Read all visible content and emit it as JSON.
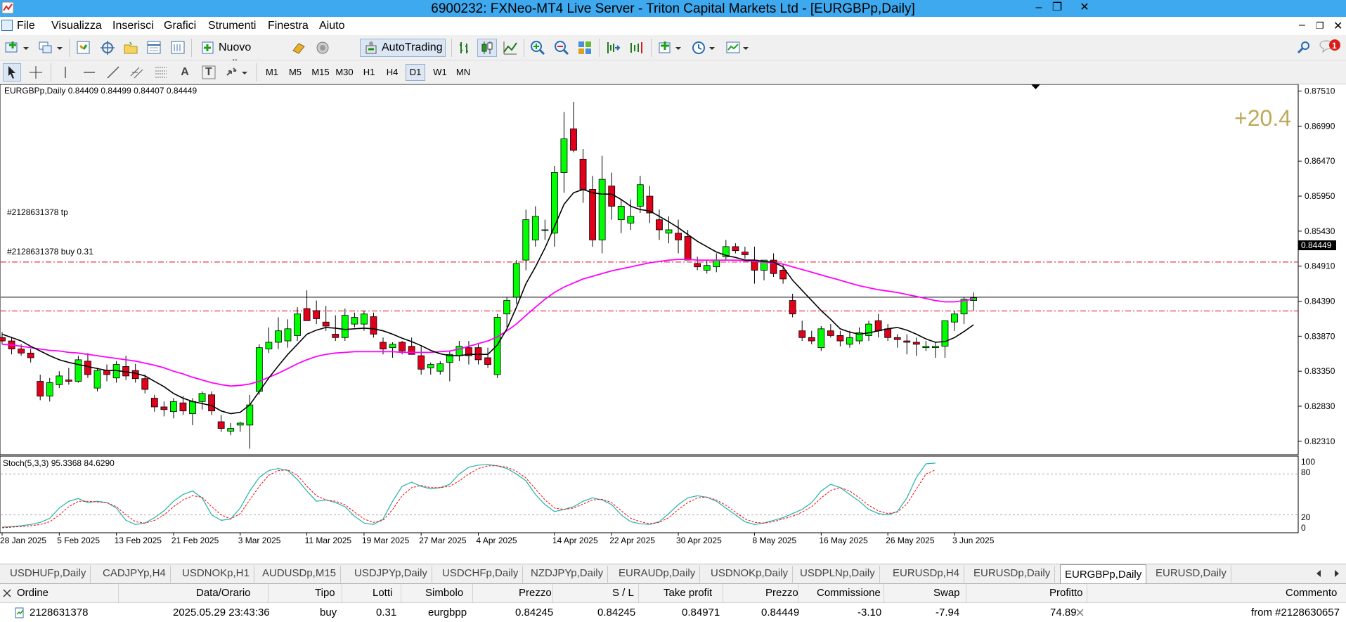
{
  "window": {
    "title": "6900232: FXNeo-MT4 Live Server - Triton Capital Markets Ltd - [EURGBPp,Daily]",
    "controls": [
      "–",
      "❐",
      "✕"
    ],
    "mdi_controls": [
      "–",
      "❐",
      "✕"
    ]
  },
  "menu": [
    "File",
    "Visualizza",
    "Inserisci",
    "Grafici",
    "Strumenti",
    "Finestra",
    "Aiuto"
  ],
  "toolbar": {
    "new_order_label": "Nuovo ordine",
    "autotrading_label": "AutoTrading",
    "notification_count": "1"
  },
  "drawing_tools": {
    "text_tool": "A",
    "label_tool": "T"
  },
  "timeframes": [
    "M1",
    "M5",
    "M15",
    "M30",
    "H1",
    "H4",
    "D1",
    "W1",
    "MN"
  ],
  "selected_timeframe": "D1",
  "chart": {
    "header": "EURGBPp,Daily  0.84409 0.84499 0.84407 0.84449",
    "profit_overlay": "+20.4",
    "tp_label": "#2128631378 tp",
    "buy_label": "#2128631378 buy 0.31",
    "current_price": "0.84449",
    "colors": {
      "bull": "#00ff00",
      "bear": "#e0001a",
      "ma_fast": "#000000",
      "ma_slow": "#ff00ff",
      "stoch_main": "#20b2aa",
      "stoch_signal": "#ff0000",
      "profit": "#bfa95a"
    }
  },
  "stoch": {
    "header": "Stoch(5,3,3) 95.3368 84.6290",
    "levels": [
      "100",
      "80",
      "20",
      "0"
    ]
  },
  "chart_data": {
    "type": "candlestick",
    "title": "EURGBPp,Daily",
    "y_ticks": [
      "0.87510",
      "0.86990",
      "0.86470",
      "0.85950",
      "0.85430",
      "0.84910",
      "0.84390",
      "0.83870",
      "0.83350",
      "0.82830",
      "0.82310"
    ],
    "ylim": [
      0.8211,
      0.8761
    ],
    "x_labels": [
      "28 Jan 2025",
      "5 Feb 2025",
      "13 Feb 2025",
      "21 Feb 2025",
      "3 Mar 2025",
      "11 Mar 2025",
      "19 Mar 2025",
      "27 Mar 2025",
      "4 Apr 2025",
      "14 Apr 2025",
      "22 Apr 2025",
      "30 Apr 2025",
      "8 May 2025",
      "16 May 2025",
      "26 May 2025",
      "3 Jun 2025"
    ],
    "ohlc": [
      [
        0.8385,
        0.8393,
        0.8375,
        0.838
      ],
      [
        0.838,
        0.8386,
        0.836,
        0.8368
      ],
      [
        0.8368,
        0.8375,
        0.8358,
        0.8362
      ],
      [
        0.8362,
        0.8368,
        0.8348,
        0.8355
      ],
      [
        0.832,
        0.833,
        0.8292,
        0.8298
      ],
      [
        0.8298,
        0.8325,
        0.829,
        0.8318
      ],
      [
        0.8315,
        0.8335,
        0.831,
        0.8328
      ],
      [
        0.8322,
        0.834,
        0.8315,
        0.832
      ],
      [
        0.832,
        0.8358,
        0.8318,
        0.8352
      ],
      [
        0.835,
        0.8362,
        0.8325,
        0.833
      ],
      [
        0.831,
        0.834,
        0.8305,
        0.8336
      ],
      [
        0.8336,
        0.8345,
        0.832,
        0.833
      ],
      [
        0.8325,
        0.835,
        0.8318,
        0.8345
      ],
      [
        0.8342,
        0.8358,
        0.8322,
        0.8328
      ],
      [
        0.8336,
        0.8346,
        0.8318,
        0.8324
      ],
      [
        0.8324,
        0.833,
        0.8302,
        0.8308
      ],
      [
        0.8295,
        0.83,
        0.8275,
        0.8282
      ],
      [
        0.8282,
        0.829,
        0.8268,
        0.8278
      ],
      [
        0.8275,
        0.8295,
        0.8265,
        0.829
      ],
      [
        0.8288,
        0.8298,
        0.827,
        0.8276
      ],
      [
        0.8272,
        0.8295,
        0.8255,
        0.829
      ],
      [
        0.829,
        0.8305,
        0.8278,
        0.8302
      ],
      [
        0.83,
        0.8305,
        0.827,
        0.8276
      ],
      [
        0.826,
        0.827,
        0.8245,
        0.825
      ],
      [
        0.8246,
        0.8258,
        0.824,
        0.825
      ],
      [
        0.8255,
        0.826,
        0.8245,
        0.8258
      ],
      [
        0.8255,
        0.83,
        0.822,
        0.8285
      ],
      [
        0.8305,
        0.8375,
        0.83,
        0.837
      ],
      [
        0.8368,
        0.84,
        0.8362,
        0.8378
      ],
      [
        0.8378,
        0.8415,
        0.8368,
        0.8395
      ],
      [
        0.838,
        0.8412,
        0.837,
        0.8398
      ],
      [
        0.8388,
        0.843,
        0.838,
        0.842
      ],
      [
        0.8428,
        0.8455,
        0.841,
        0.841
      ],
      [
        0.8425,
        0.844,
        0.8405,
        0.8413
      ],
      [
        0.8408,
        0.8432,
        0.8395,
        0.8402
      ],
      [
        0.839,
        0.8418,
        0.838,
        0.8385
      ],
      [
        0.8385,
        0.8428,
        0.838,
        0.8418
      ],
      [
        0.8405,
        0.8422,
        0.84,
        0.8415
      ],
      [
        0.8405,
        0.8425,
        0.8395,
        0.842
      ],
      [
        0.8416,
        0.8422,
        0.8385,
        0.839
      ],
      [
        0.8378,
        0.8385,
        0.836,
        0.8368
      ],
      [
        0.837,
        0.8378,
        0.8355,
        0.8375
      ],
      [
        0.8378,
        0.838,
        0.836,
        0.8365
      ],
      [
        0.8372,
        0.8385,
        0.8365,
        0.836
      ],
      [
        0.8358,
        0.8372,
        0.833,
        0.8338
      ],
      [
        0.834,
        0.8348,
        0.833,
        0.8345
      ],
      [
        0.8335,
        0.835,
        0.833,
        0.8346
      ],
      [
        0.8348,
        0.8365,
        0.832,
        0.836
      ],
      [
        0.8358,
        0.838,
        0.835,
        0.8372
      ],
      [
        0.837,
        0.838,
        0.8345,
        0.8358
      ],
      [
        0.837,
        0.8375,
        0.8345,
        0.8352
      ],
      [
        0.8355,
        0.837,
        0.834,
        0.8345
      ],
      [
        0.833,
        0.842,
        0.8325,
        0.8415
      ],
      [
        0.842,
        0.8445,
        0.84,
        0.844
      ],
      [
        0.8445,
        0.85,
        0.8435,
        0.8495
      ],
      [
        0.85,
        0.8575,
        0.8485,
        0.856
      ],
      [
        0.853,
        0.858,
        0.852,
        0.8565
      ],
      [
        0.8545,
        0.856,
        0.853,
        0.8545
      ],
      [
        0.854,
        0.864,
        0.852,
        0.863
      ],
      [
        0.863,
        0.872,
        0.86,
        0.868
      ],
      [
        0.8695,
        0.8735,
        0.866,
        0.8663
      ],
      [
        0.865,
        0.8665,
        0.8585,
        0.8605
      ],
      [
        0.8605,
        0.8625,
        0.852,
        0.853
      ],
      [
        0.853,
        0.8655,
        0.851,
        0.862
      ],
      [
        0.861,
        0.863,
        0.856,
        0.858
      ],
      [
        0.856,
        0.859,
        0.854,
        0.858
      ],
      [
        0.8555,
        0.859,
        0.8545,
        0.8565
      ],
      [
        0.858,
        0.8625,
        0.857,
        0.8612
      ],
      [
        0.8595,
        0.861,
        0.8555,
        0.857
      ],
      [
        0.856,
        0.8575,
        0.853,
        0.8545
      ],
      [
        0.854,
        0.8565,
        0.8525,
        0.8545
      ],
      [
        0.854,
        0.856,
        0.851,
        0.853
      ],
      [
        0.8535,
        0.8545,
        0.85,
        0.85
      ],
      [
        0.8495,
        0.8505,
        0.8485,
        0.849
      ],
      [
        0.8485,
        0.85,
        0.848,
        0.8492
      ],
      [
        0.849,
        0.851,
        0.8482,
        0.85
      ],
      [
        0.8505,
        0.853,
        0.85,
        0.852
      ],
      [
        0.852,
        0.8525,
        0.851,
        0.8514
      ],
      [
        0.8512,
        0.852,
        0.8502,
        0.8508
      ],
      [
        0.85,
        0.852,
        0.8465,
        0.8485
      ],
      [
        0.8485,
        0.85,
        0.847,
        0.85
      ],
      [
        0.85,
        0.851,
        0.8475,
        0.848
      ],
      [
        0.8485,
        0.8495,
        0.8465,
        0.8472
      ],
      [
        0.844,
        0.845,
        0.8415,
        0.842
      ],
      [
        0.8395,
        0.841,
        0.838,
        0.8385
      ],
      [
        0.8385,
        0.8395,
        0.8375,
        0.838
      ],
      [
        0.837,
        0.8402,
        0.8365,
        0.8398
      ],
      [
        0.8395,
        0.8405,
        0.8385,
        0.8388
      ],
      [
        0.8388,
        0.8395,
        0.8372,
        0.838
      ],
      [
        0.8375,
        0.8395,
        0.837,
        0.8385
      ],
      [
        0.838,
        0.84,
        0.8375,
        0.8392
      ],
      [
        0.8388,
        0.841,
        0.838,
        0.8405
      ],
      [
        0.841,
        0.842,
        0.8385,
        0.8395
      ],
      [
        0.8398,
        0.8405,
        0.838,
        0.8385
      ],
      [
        0.8385,
        0.839,
        0.837,
        0.8382
      ],
      [
        0.838,
        0.839,
        0.836,
        0.8378
      ],
      [
        0.8378,
        0.8385,
        0.8358,
        0.8375
      ],
      [
        0.837,
        0.838,
        0.8365,
        0.8372
      ],
      [
        0.837,
        0.8378,
        0.8355,
        0.8372
      ],
      [
        0.8372,
        0.841,
        0.8355,
        0.841
      ],
      [
        0.8408,
        0.8425,
        0.8395,
        0.842
      ],
      [
        0.842,
        0.8445,
        0.8405,
        0.8442
      ],
      [
        0.844,
        0.8452,
        0.8425,
        0.8444
      ]
    ],
    "ma_slow": [
      0.8375,
      0.8374,
      0.8372,
      0.837,
      0.8368,
      0.8366,
      0.8365,
      0.8363,
      0.8362,
      0.836,
      0.8358,
      0.8356,
      0.8354,
      0.8352,
      0.835,
      0.8347,
      0.8344,
      0.834,
      0.8335,
      0.8331,
      0.8326,
      0.8322,
      0.8318,
      0.8315,
      0.8313,
      0.8314,
      0.8316,
      0.832,
      0.8326,
      0.8332,
      0.8339,
      0.8346,
      0.8352,
      0.8357,
      0.836,
      0.8362,
      0.8363,
      0.8364,
      0.8364,
      0.8364,
      0.8364,
      0.8364,
      0.8363,
      0.8363,
      0.8363,
      0.8363,
      0.8364,
      0.8365,
      0.8368,
      0.8372,
      0.8376,
      0.838,
      0.8386,
      0.8395,
      0.8405,
      0.8418,
      0.843,
      0.8442,
      0.8452,
      0.846,
      0.8466,
      0.8472,
      0.8476,
      0.848,
      0.8484,
      0.8487,
      0.849,
      0.8493,
      0.8496,
      0.8498,
      0.85,
      0.8501,
      0.8501,
      0.85,
      0.85,
      0.85,
      0.85,
      0.85,
      0.8499,
      0.8498,
      0.8497,
      0.8496,
      0.8494,
      0.849,
      0.8486,
      0.8482,
      0.8478,
      0.8474,
      0.847,
      0.8466,
      0.8462,
      0.8459,
      0.8456,
      0.8454,
      0.8452,
      0.8449,
      0.8446,
      0.8443,
      0.844,
      0.8438,
      0.8438,
      0.844,
      0.8442
    ],
    "ma_fast": [
      0.839,
      0.8385,
      0.838,
      0.8372,
      0.8365,
      0.8358,
      0.8352,
      0.8348,
      0.8345,
      0.8342,
      0.8339,
      0.8336,
      0.8336,
      0.8334,
      0.8332,
      0.8328,
      0.832,
      0.8312,
      0.8302,
      0.8295,
      0.829,
      0.8287,
      0.8284,
      0.8276,
      0.8272,
      0.8274,
      0.8285,
      0.8305,
      0.8325,
      0.8343,
      0.836,
      0.8375,
      0.839,
      0.8396,
      0.84,
      0.8399,
      0.8397,
      0.8398,
      0.8399,
      0.8398,
      0.8395,
      0.839,
      0.8384,
      0.8379,
      0.8373,
      0.8366,
      0.8361,
      0.8358,
      0.8358,
      0.836,
      0.836,
      0.836,
      0.8374,
      0.8398,
      0.843,
      0.8465,
      0.849,
      0.8518,
      0.855,
      0.8583,
      0.86,
      0.8605,
      0.86,
      0.8598,
      0.8598,
      0.859,
      0.858,
      0.8575,
      0.8573,
      0.8565,
      0.8557,
      0.8548,
      0.8538,
      0.8528,
      0.852,
      0.8512,
      0.8507,
      0.8504,
      0.85,
      0.85,
      0.8498,
      0.8497,
      0.849,
      0.847,
      0.8455,
      0.844,
      0.8425,
      0.8412,
      0.8398,
      0.8393,
      0.839,
      0.8392,
      0.8395,
      0.8398,
      0.84,
      0.8396,
      0.839,
      0.8383,
      0.8378,
      0.8379,
      0.8385,
      0.8394,
      0.8404
    ],
    "stoch_main": [
      2,
      3,
      4,
      6,
      9,
      15,
      30,
      40,
      44,
      38,
      40,
      38,
      30,
      12,
      6,
      8,
      16,
      26,
      40,
      50,
      55,
      45,
      20,
      12,
      14,
      30,
      55,
      75,
      85,
      88,
      85,
      72,
      55,
      40,
      42,
      38,
      32,
      18,
      8,
      6,
      14,
      40,
      62,
      68,
      62,
      58,
      60,
      65,
      80,
      90,
      93,
      94,
      92,
      88,
      80,
      70,
      50,
      35,
      25,
      28,
      32,
      40,
      45,
      42,
      35,
      20,
      10,
      7,
      6,
      10,
      22,
      35,
      45,
      48,
      46,
      40,
      30,
      20,
      10,
      6,
      8,
      12,
      16,
      22,
      28,
      38,
      55,
      65,
      60,
      50,
      40,
      28,
      22,
      20,
      25,
      45,
      75,
      95,
      96
    ],
    "stoch_signal": [
      1,
      2,
      3,
      4,
      6,
      10,
      20,
      32,
      40,
      40,
      39,
      38,
      32,
      20,
      10,
      8,
      12,
      20,
      32,
      42,
      48,
      46,
      32,
      20,
      14,
      22,
      42,
      62,
      78,
      85,
      86,
      78,
      62,
      48,
      42,
      40,
      35,
      24,
      14,
      9,
      12,
      28,
      48,
      60,
      63,
      60,
      60,
      62,
      70,
      80,
      88,
      92,
      92,
      90,
      84,
      74,
      58,
      42,
      30,
      28,
      30,
      36,
      42,
      43,
      38,
      26,
      15,
      10,
      7,
      9,
      16,
      28,
      38,
      45,
      46,
      42,
      34,
      24,
      14,
      9,
      8,
      10,
      14,
      18,
      24,
      32,
      45,
      56,
      60,
      55,
      45,
      34,
      26,
      22,
      24,
      36,
      58,
      80,
      86
    ]
  },
  "tabs": [
    "USDHUFp,Daily",
    "CADJPYp,H4",
    "USDNOKp,H1",
    "AUDUSDp,M15",
    "USDJPYp,Daily",
    "USDCHFp,Daily",
    "NZDJPYp,Daily",
    "EURAUDp,Daily",
    "USDNOKp,Daily",
    "USDPLNp,Daily",
    "EURUSDp,H4",
    "EURUSDp,Daily",
    "EURGBPp,Daily",
    "EURUSD,Daily"
  ],
  "active_tab": "EURGBPp,Daily",
  "terminal": {
    "headers": [
      "Ordine",
      "Data/Orario",
      "Tipo",
      "Lotti",
      "Simbolo",
      "Prezzo",
      "S / L",
      "Take profit",
      "Prezzo",
      "Commissione",
      "Swap",
      "Profitto",
      "Commento"
    ],
    "row": [
      "2128631378",
      "2025.05.29 23:43:36",
      "buy",
      "0.31",
      "eurgbpp",
      "0.84245",
      "0.84245",
      "0.84971",
      "0.84449",
      "-3.10",
      "-7.94",
      "74.89",
      "from #2128630657"
    ]
  }
}
